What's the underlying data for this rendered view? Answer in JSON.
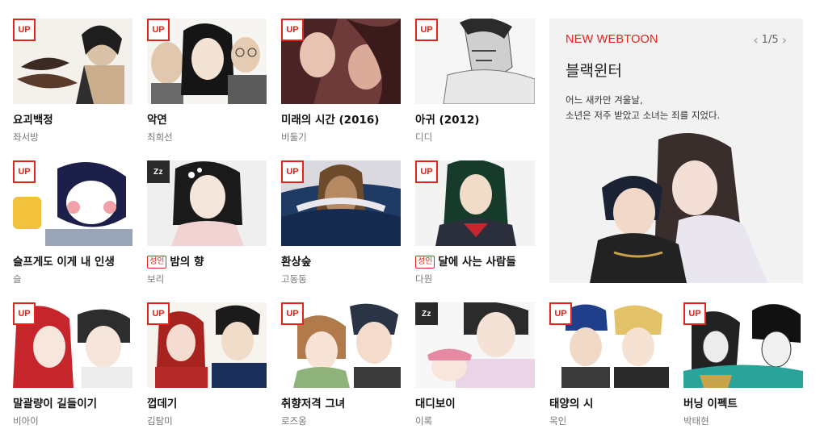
{
  "badges": {
    "up": "UP",
    "zz": "Zz",
    "adult": "성인"
  },
  "colors": {
    "accent": "#e5231b",
    "feature_bg": "#f2f2f2"
  },
  "rows": [
    [
      {
        "title": "요괴백정",
        "author": "좌서방",
        "badge": "up",
        "adult": false
      },
      {
        "title": "악연",
        "author": "최희선",
        "badge": "up",
        "adult": false
      },
      {
        "title": "미래의 시간 (2016)",
        "author": "비둘기",
        "badge": "up",
        "adult": false
      },
      {
        "title": "아귀 (2012)",
        "author": "디디",
        "badge": "up",
        "adult": false
      }
    ],
    [
      {
        "title": "슬프게도 이게 내 인생",
        "author": "슬",
        "badge": "up",
        "adult": false
      },
      {
        "title": "밤의 향",
        "author": "보리",
        "badge": "zz",
        "adult": true
      },
      {
        "title": "환상숲",
        "author": "고동동",
        "badge": "up",
        "adult": false
      },
      {
        "title": "달에 사는 사람들",
        "author": "다원",
        "badge": "up",
        "adult": true
      }
    ],
    [
      {
        "title": "말괄량이 길들이기",
        "author": "비아이",
        "badge": "up",
        "adult": false
      },
      {
        "title": "껍데기",
        "author": "김탐미",
        "badge": "up",
        "adult": false
      },
      {
        "title": "취향저격 그녀",
        "author": "로즈옹",
        "badge": "up",
        "adult": false
      },
      {
        "title": "대디보이",
        "author": "이록",
        "badge": "zz",
        "adult": false
      },
      {
        "title": "태양의 시",
        "author": "목인",
        "badge": "up",
        "adult": false
      },
      {
        "title": "버닝 이펙트",
        "author": "박태현",
        "badge": "up",
        "adult": false
      }
    ]
  ],
  "feature": {
    "label": "NEW WEBTOON",
    "pager": "1/5",
    "title": "블랙윈터",
    "desc_line1": "어느 새카만 겨울날,",
    "desc_line2": "소년은 저주 받았고 소녀는 죄를 지었다."
  }
}
